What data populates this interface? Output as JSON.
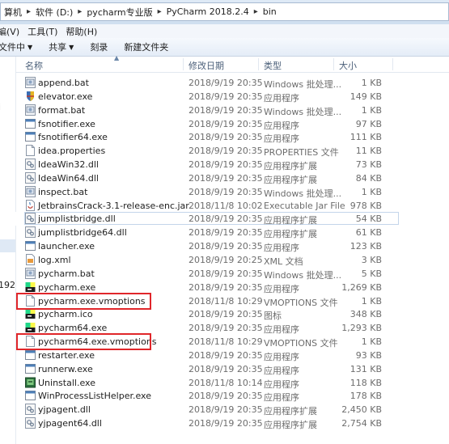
{
  "address": {
    "crumbs": [
      "算机",
      "软件 (D:)",
      "pycharm专业版",
      "PyCharm 2018.2.4",
      "bin"
    ]
  },
  "menu": [
    "編(V)",
    "工具(T)",
    "帮助(H)"
  ],
  "toolbar": {
    "organize": "文件中",
    "share": "共享",
    "burn": "刻录",
    "new_folder": "新建文件夹"
  },
  "nav_glyphs": [
    "i",
    "192."
  ],
  "columns": {
    "name": "名称",
    "date": "修改日期",
    "type": "类型",
    "size": "大小"
  },
  "files": [
    {
      "name": "append.bat",
      "date": "2018/9/19 20:35",
      "type": "Windows 批处理...",
      "size": "1 KB",
      "icon": "bat-icon"
    },
    {
      "name": "elevator.exe",
      "date": "2018/9/19 20:35",
      "type": "应用程序",
      "size": "149 KB",
      "icon": "elevator-exe-icon"
    },
    {
      "name": "format.bat",
      "date": "2018/9/19 20:35",
      "type": "Windows 批处理...",
      "size": "1 KB",
      "icon": "bat-icon"
    },
    {
      "name": "fsnotifier.exe",
      "date": "2018/9/19 20:35",
      "type": "应用程序",
      "size": "97 KB",
      "icon": "exe-icon"
    },
    {
      "name": "fsnotifier64.exe",
      "date": "2018/9/19 20:35",
      "type": "应用程序",
      "size": "111 KB",
      "icon": "exe-icon"
    },
    {
      "name": "idea.properties",
      "date": "2018/9/19 20:35",
      "type": "PROPERTIES 文件",
      "size": "11 KB",
      "icon": "file-icon"
    },
    {
      "name": "IdeaWin32.dll",
      "date": "2018/9/19 20:35",
      "type": "应用程序扩展",
      "size": "73 KB",
      "icon": "dll-icon"
    },
    {
      "name": "IdeaWin64.dll",
      "date": "2018/9/19 20:35",
      "type": "应用程序扩展",
      "size": "84 KB",
      "icon": "dll-icon"
    },
    {
      "name": "inspect.bat",
      "date": "2018/9/19 20:35",
      "type": "Windows 批处理...",
      "size": "1 KB",
      "icon": "bat-icon"
    },
    {
      "name": "JetbrainsCrack-3.1-release-enc.jar",
      "date": "2018/11/8 10:02",
      "type": "Executable Jar File",
      "size": "978 KB",
      "icon": "jar-icon"
    },
    {
      "name": "jumplistbridge.dll",
      "date": "2018/9/19 20:35",
      "type": "应用程序扩展",
      "size": "54 KB",
      "icon": "dll-icon"
    },
    {
      "name": "jumplistbridge64.dll",
      "date": "2018/9/19 20:35",
      "type": "应用程序扩展",
      "size": "61 KB",
      "icon": "dll-icon"
    },
    {
      "name": "launcher.exe",
      "date": "2018/9/19 20:35",
      "type": "应用程序",
      "size": "123 KB",
      "icon": "exe-icon"
    },
    {
      "name": "log.xml",
      "date": "2018/9/19 20:25",
      "type": "XML 文档",
      "size": "3 KB",
      "icon": "xml-icon"
    },
    {
      "name": "pycharm.bat",
      "date": "2018/9/19 20:35",
      "type": "Windows 批处理...",
      "size": "5 KB",
      "icon": "bat-icon"
    },
    {
      "name": "pycharm.exe",
      "date": "2018/9/19 20:35",
      "type": "应用程序",
      "size": "1,269 KB",
      "icon": "pycharm-icon"
    },
    {
      "name": "pycharm.exe.vmoptions",
      "date": "2018/11/8 10:29",
      "type": "VMOPTIONS 文件",
      "size": "1 KB",
      "icon": "file-icon"
    },
    {
      "name": "pycharm.ico",
      "date": "2018/9/19 20:35",
      "type": "图标",
      "size": "348 KB",
      "icon": "pycharm-icon"
    },
    {
      "name": "pycharm64.exe",
      "date": "2018/9/19 20:35",
      "type": "应用程序",
      "size": "1,293 KB",
      "icon": "pycharm-icon"
    },
    {
      "name": "pycharm64.exe.vmoptions",
      "date": "2018/11/8 10:29",
      "type": "VMOPTIONS 文件",
      "size": "1 KB",
      "icon": "file-icon"
    },
    {
      "name": "restarter.exe",
      "date": "2018/9/19 20:35",
      "type": "应用程序",
      "size": "93 KB",
      "icon": "exe-icon"
    },
    {
      "name": "runnerw.exe",
      "date": "2018/9/19 20:35",
      "type": "应用程序",
      "size": "131 KB",
      "icon": "exe-icon"
    },
    {
      "name": "Uninstall.exe",
      "date": "2018/11/8 10:14",
      "type": "应用程序",
      "size": "118 KB",
      "icon": "uninstall-icon"
    },
    {
      "name": "WinProcessListHelper.exe",
      "date": "2018/9/19 20:35",
      "type": "应用程序",
      "size": "178 KB",
      "icon": "exe-icon"
    },
    {
      "name": "yjpagent.dll",
      "date": "2018/9/19 20:35",
      "type": "应用程序扩展",
      "size": "2,450 KB",
      "icon": "dll-icon"
    },
    {
      "name": "yjpagent64.dll",
      "date": "2018/9/19 20:35",
      "type": "应用程序扩展",
      "size": "2,754 KB",
      "icon": "dll-icon"
    }
  ],
  "selected_row": 10,
  "highlighted_rows": [
    16,
    19
  ],
  "colors": {
    "highlight_border": "#e0262a",
    "selection_border": "#c3d5ea"
  }
}
